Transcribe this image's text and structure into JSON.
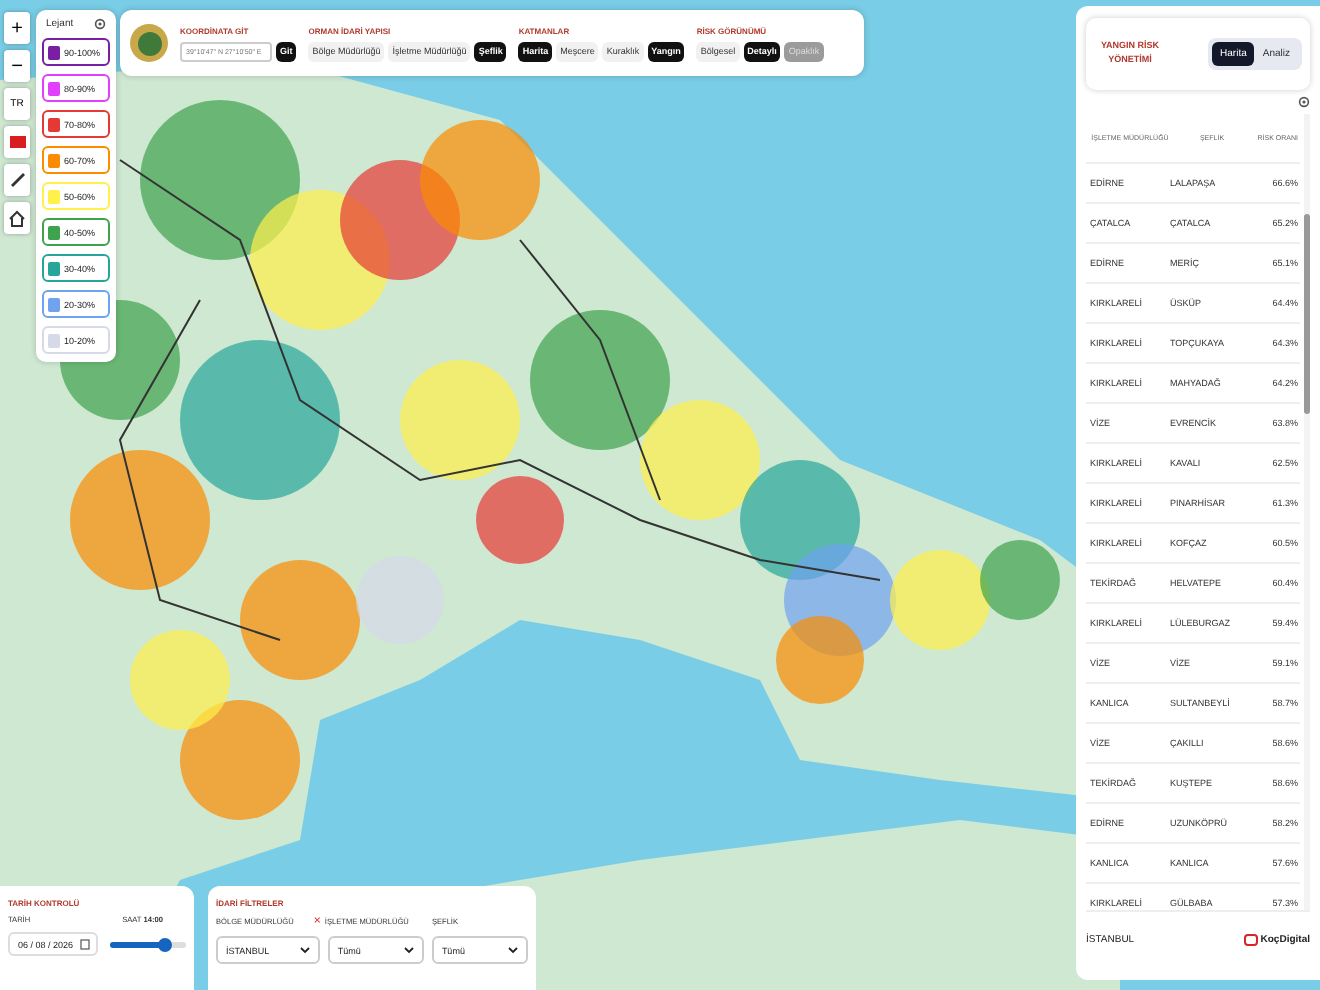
{
  "map_controls": {
    "zoom_in": "+",
    "zoom_out": "−",
    "language": "TR"
  },
  "legend": {
    "title": "Lejant",
    "items": [
      {
        "label": "90-100%",
        "color": "#7b1fa2"
      },
      {
        "label": "80-90%",
        "color": "#e040fb"
      },
      {
        "label": "70-80%",
        "color": "#e53935"
      },
      {
        "label": "60-70%",
        "color": "#fb8c00"
      },
      {
        "label": "50-60%",
        "color": "#fff04a"
      },
      {
        "label": "40-50%",
        "color": "#3fa34d"
      },
      {
        "label": "30-40%",
        "color": "#26a69a"
      },
      {
        "label": "20-30%",
        "color": "#6fa3ef"
      },
      {
        "label": "10-20%",
        "color": "#d5d9e8"
      }
    ]
  },
  "toolbar": {
    "groups": [
      {
        "kind": "coords",
        "title": "KOORDİNATA GİT",
        "placeholder": "39°10'47\" N 27°10'50\" E",
        "button": "Git"
      },
      {
        "kind": "buttons",
        "title": "ORMAN İDARİ YAPISI",
        "buttons": [
          {
            "label": "Bölge Müdürlüğü",
            "selected": false,
            "disabled": false
          },
          {
            "label": "İşletme Müdürlüğü",
            "selected": false,
            "disabled": false
          },
          {
            "label": "Şeflik",
            "selected": true,
            "disabled": false
          }
        ]
      },
      {
        "kind": "buttons",
        "title": "KATMANLAR",
        "buttons": [
          {
            "label": "Harita",
            "selected": true,
            "disabled": false
          },
          {
            "label": "Meşcere",
            "selected": false,
            "disabled": false
          },
          {
            "label": "Kuraklık",
            "selected": false,
            "disabled": false
          },
          {
            "label": "Yangın",
            "selected": true,
            "disabled": false
          }
        ]
      },
      {
        "kind": "buttons",
        "title": "RİSK GÖRÜNÜMÜ",
        "buttons": [
          {
            "label": "Bölgesel",
            "selected": false,
            "disabled": false
          },
          {
            "label": "Detaylı",
            "selected": true,
            "disabled": false
          },
          {
            "label": "Opaklık",
            "selected": false,
            "disabled": true
          }
        ]
      }
    ]
  },
  "risk_panel": {
    "title": "YANGIN RİSK YÖNETİMİ",
    "tabs": [
      {
        "label": "Harita",
        "selected": true
      },
      {
        "label": "Analiz",
        "selected": false
      }
    ],
    "columns": [
      "İŞLETME MÜDÜRLÜĞÜ",
      "ŞEFLİK",
      "RİSK ORANI"
    ],
    "rows": [
      [
        "EDİRNE",
        "LALAPAŞA",
        "66.6%"
      ],
      [
        "ÇATALCA",
        "ÇATALCA",
        "65.2%"
      ],
      [
        "EDİRNE",
        "MERİÇ",
        "65.1%"
      ],
      [
        "KIRKLARELİ",
        "ÜSKÜP",
        "64.4%"
      ],
      [
        "KIRKLARELİ",
        "TOPÇUKAYA",
        "64.3%"
      ],
      [
        "KIRKLARELİ",
        "MAHYADAĞ",
        "64.2%"
      ],
      [
        "VİZE",
        "EVRENCİK",
        "63.8%"
      ],
      [
        "KIRKLARELİ",
        "KAVALI",
        "62.5%"
      ],
      [
        "KIRKLARELİ",
        "PINARHİSAR",
        "61.3%"
      ],
      [
        "KIRKLARELİ",
        "KOFÇAZ",
        "60.5%"
      ],
      [
        "TEKİRDAĞ",
        "HELVATEPE",
        "60.4%"
      ],
      [
        "KIRKLARELİ",
        "LÜLEBURGAZ",
        "59.4%"
      ],
      [
        "VİZE",
        "VİZE",
        "59.1%"
      ],
      [
        "KANLICA",
        "SULTANBEYLİ",
        "58.7%"
      ],
      [
        "VİZE",
        "ÇAKILLI",
        "58.6%"
      ],
      [
        "TEKİRDAĞ",
        "KUŞTEPE",
        "58.6%"
      ],
      [
        "EDİRNE",
        "UZUNKÖPRÜ",
        "58.2%"
      ],
      [
        "KANLICA",
        "KANLICA",
        "57.6%"
      ],
      [
        "KIRKLARELİ",
        "GÜLBABA",
        "57.3%"
      ]
    ],
    "footer": "İSTANBUL",
    "brand": "KoçDigital"
  },
  "date_panel": {
    "title": "TARİH KONTROLÜ",
    "date_label": "TARİH",
    "date": "06 / 08 / 2026",
    "time_label": "SAAT",
    "time": "14:00",
    "level": 0.72
  },
  "filters": {
    "title": "İDARİ FİLTRELER",
    "clear": "×",
    "fields": [
      {
        "label": "BÖLGE MÜDÜRLÜĞÜ",
        "value": "İSTANBUL"
      },
      {
        "label": "İŞLETME MÜDÜRLÜĞÜ",
        "value": "Tümü"
      },
      {
        "label": "ŞEFLİK",
        "value": "Tümü"
      }
    ]
  }
}
